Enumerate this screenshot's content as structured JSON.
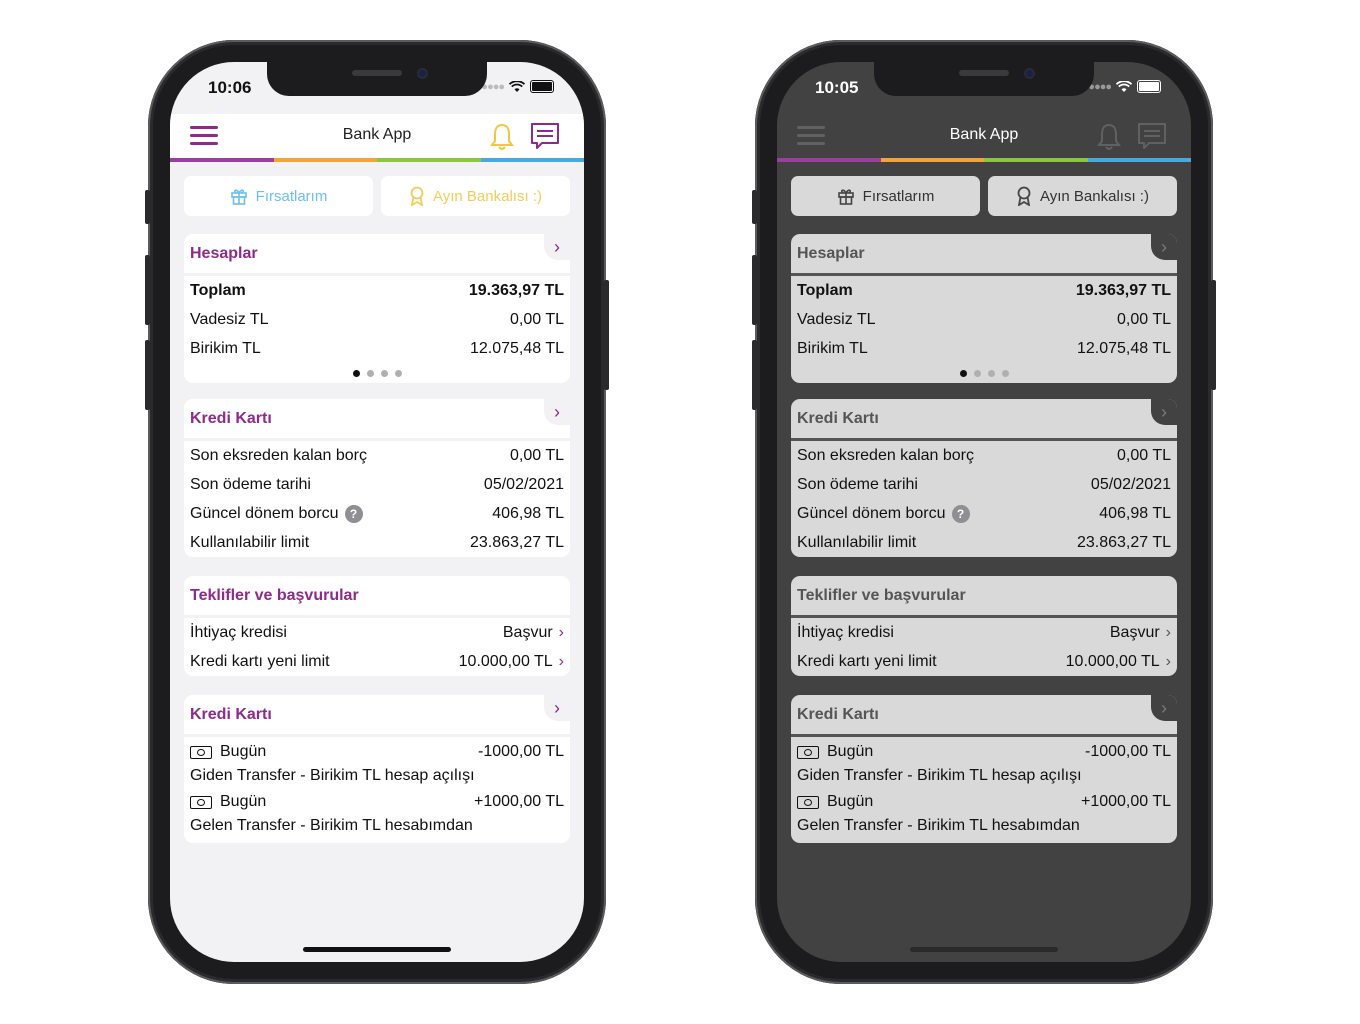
{
  "phones": [
    {
      "theme": "light",
      "status": {
        "time": "10:06"
      },
      "nav": {
        "title": "Bank App",
        "menu_icon": "hamburger-icon",
        "bell_icon": "bell-icon",
        "chat_icon": "chat-icon"
      },
      "stripe_colors": [
        "#9b3ea0",
        "#f2a33a",
        "#8cc63f",
        "#4aa8e0"
      ],
      "promo": {
        "gifts_label": "Fırsatlarım",
        "award_label": "Ayın Bankalısı :)"
      },
      "accounts": {
        "title": "Hesaplar",
        "rows": [
          {
            "label": "Toplam",
            "value": "19.363,97 TL"
          },
          {
            "label": "Vadesiz TL",
            "value": "0,00 TL"
          },
          {
            "label": "Birikim TL",
            "value": "12.075,48 TL"
          }
        ]
      },
      "credit_card": {
        "title": "Kredi Kartı",
        "rows": [
          {
            "label": "Son eksreden kalan borç",
            "value": "0,00 TL"
          },
          {
            "label": "Son ödeme tarihi",
            "value": "05/02/2021"
          },
          {
            "label": "Güncel dönem borcu",
            "value": "406,98 TL",
            "help": "?"
          },
          {
            "label": "Kullanılabilir limit",
            "value": "23.863,27 TL"
          }
        ]
      },
      "offers": {
        "title": "Teklifler ve başvurular",
        "rows": [
          {
            "label": "İhtiyaç kredisi",
            "value": "Başvur"
          },
          {
            "label": "Kredi kartı yeni limit",
            "value": "10.000,00 TL"
          }
        ]
      },
      "transactions": {
        "title": "Kredi Kartı",
        "items": [
          {
            "date": "Bugün",
            "amount": "-1000,00 TL",
            "desc": "Giden Transfer - Birikim TL hesap açılışı"
          },
          {
            "date": "Bugün",
            "amount": "+1000,00 TL",
            "desc": "Gelen Transfer - Birikim TL hesabımdan"
          }
        ]
      }
    },
    {
      "theme": "dark",
      "status": {
        "time": "10:05"
      },
      "nav": {
        "title": "Bank App",
        "menu_icon": "hamburger-icon",
        "bell_icon": "bell-icon",
        "chat_icon": "chat-icon"
      },
      "stripe_colors": [
        "#9b3ea0",
        "#f2a33a",
        "#8cc63f",
        "#4aa8e0"
      ],
      "promo": {
        "gifts_label": "Fırsatlarım",
        "award_label": "Ayın Bankalısı :)"
      },
      "accounts": {
        "title": "Hesaplar",
        "rows": [
          {
            "label": "Toplam",
            "value": "19.363,97 TL"
          },
          {
            "label": "Vadesiz TL",
            "value": "0,00 TL"
          },
          {
            "label": "Birikim TL",
            "value": "12.075,48 TL"
          }
        ]
      },
      "credit_card": {
        "title": "Kredi Kartı",
        "rows": [
          {
            "label": "Son eksreden kalan borç",
            "value": "0,00 TL"
          },
          {
            "label": "Son ödeme tarihi",
            "value": "05/02/2021"
          },
          {
            "label": "Güncel dönem borcu",
            "value": "406,98 TL",
            "help": "?"
          },
          {
            "label": "Kullanılabilir limit",
            "value": "23.863,27 TL"
          }
        ]
      },
      "offers": {
        "title": "Teklifler ve başvurular",
        "rows": [
          {
            "label": "İhtiyaç kredisi",
            "value": "Başvur"
          },
          {
            "label": "Kredi kartı yeni limit",
            "value": "10.000,00 TL"
          }
        ]
      },
      "transactions": {
        "title": "Kredi Kartı",
        "items": [
          {
            "date": "Bugün",
            "amount": "-1000,00 TL",
            "desc": "Giden Transfer - Birikim TL hesap açılışı"
          },
          {
            "date": "Bugün",
            "amount": "+1000,00 TL",
            "desc": "Gelen Transfer - Birikim TL hesabımdan"
          }
        ]
      }
    }
  ]
}
